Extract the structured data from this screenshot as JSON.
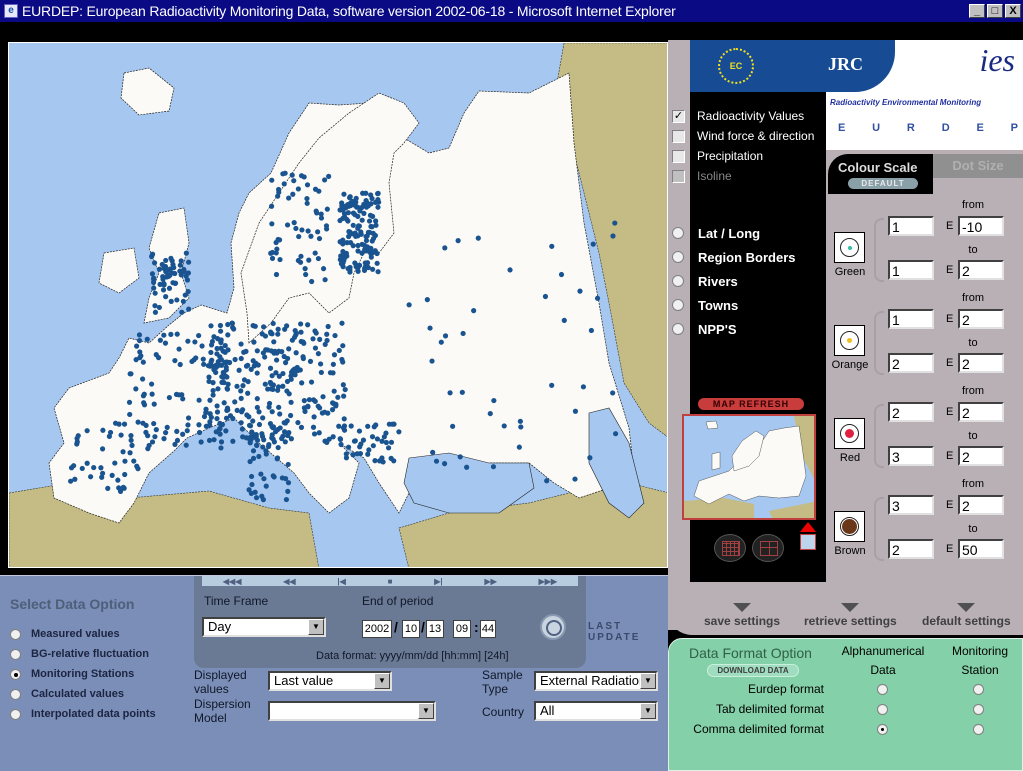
{
  "window": {
    "title": "EURDEP: European Radioactivity Monitoring Data, software version 2002-06-18 - Microsoft Internet Explorer",
    "minimize_icon": "_",
    "maximize_icon": "□",
    "close_icon": "X"
  },
  "branding": {
    "ec_label": "EC",
    "jrc_label": "JRC",
    "ies_label": "ies",
    "tagline": "Radioactivity Environmental Monitoring",
    "eurdep_letters": [
      "E",
      "U",
      "R",
      "D",
      "E",
      "P"
    ]
  },
  "layers": [
    {
      "label": "Radioactivity Values",
      "checked": true,
      "enabled": true
    },
    {
      "label": "Wind force & direction",
      "checked": false,
      "enabled": true
    },
    {
      "label": "Precipitation",
      "checked": false,
      "enabled": true
    },
    {
      "label": "Isoline",
      "checked": false,
      "enabled": false
    }
  ],
  "overlays": [
    {
      "label": "Lat / Long",
      "selected": false
    },
    {
      "label": "Region Borders",
      "selected": false
    },
    {
      "label": "Rivers",
      "selected": false
    },
    {
      "label": "Towns",
      "selected": false
    },
    {
      "label": "NPP'S",
      "selected": false
    }
  ],
  "colour_scale": {
    "tab_colour": "Colour Scale",
    "tab_dot": "Dot Size",
    "default_button": "DEFAULT",
    "from_label": "from",
    "to_label": "to",
    "exp_label": "E",
    "groups": [
      {
        "name": "Green",
        "color": "#30c0a0",
        "from_mantissa": "1",
        "from_exp": "-10",
        "to_mantissa": "1",
        "to_exp": "2"
      },
      {
        "name": "Orange",
        "color": "#f0c020",
        "from_mantissa": "1",
        "from_exp": "2",
        "to_mantissa": "2",
        "to_exp": "2"
      },
      {
        "name": "Red",
        "color": "#e02040",
        "from_mantissa": "2",
        "from_exp": "2",
        "to_mantissa": "3",
        "to_exp": "2"
      },
      {
        "name": "Brown",
        "color": "#6a3818",
        "from_mantissa": "3",
        "from_exp": "2",
        "to_mantissa": "2",
        "to_exp": "50"
      }
    ]
  },
  "map_refresh": {
    "button": "MAP REFRESH",
    "grid_fine_icon": "grid-fine-icon",
    "grid_coarse_icon": "grid-coarse-icon",
    "zoom_icon": "map-zoom-icon"
  },
  "settings": {
    "save": "save settings",
    "retrieve": "retrieve settings",
    "default": "default settings"
  },
  "data_format": {
    "title": "Data Format Option",
    "download_button": "DOWNLOAD DATA",
    "col_alpha_line1": "Alphanumerical",
    "col_alpha_line2": "Data",
    "col_station_line1": "Monitoring",
    "col_station_line2": "Station",
    "rows": [
      {
        "label": "Eurdep format",
        "alpha": false,
        "station": false
      },
      {
        "label": "Tab delimited format",
        "alpha": false,
        "station": false
      },
      {
        "label": "Comma delimited format",
        "alpha": true,
        "station": false
      }
    ]
  },
  "select_data": {
    "title": "Select Data Option",
    "options": [
      {
        "label": "Measured values",
        "selected": false
      },
      {
        "label": "BG-relative fluctuation",
        "selected": false
      },
      {
        "label": "Monitoring Stations",
        "selected": true
      },
      {
        "label": "Calculated values",
        "selected": false
      },
      {
        "label": "Interpolated data points",
        "selected": false
      }
    ]
  },
  "time_panel": {
    "nav": [
      "◀◀◀",
      "◀◀",
      "|◀",
      "■",
      "▶|",
      "▶▶",
      "▶▶▶"
    ],
    "time_frame_label": "Time Frame",
    "time_frame_value": "Day",
    "end_period_label": "End of period",
    "year": "2002",
    "month": "10",
    "day": "13",
    "hour": "09",
    "minute": "44",
    "date_sep": "/",
    "time_sep": ":",
    "format_hint": "Data format: yyyy/mm/dd [hh:mm] [24h]",
    "last_update": "LAST UPDATE"
  },
  "filters": {
    "displayed_label_1": "Displayed",
    "displayed_label_2": "values",
    "displayed_value": "Last value",
    "dispersion_label_1": "Dispersion",
    "dispersion_label_2": "Model",
    "dispersion_value": "",
    "sample_label_1": "Sample",
    "sample_label_2": "Type",
    "sample_value": "External Radiation",
    "country_label": "Country",
    "country_value": "All"
  },
  "colors": {
    "sea": "#a6c8f0",
    "land": "#fcfaf6",
    "outside_land": "#c4bc84",
    "station_dot": "#1a5490",
    "brand_blue": "#174c94"
  }
}
